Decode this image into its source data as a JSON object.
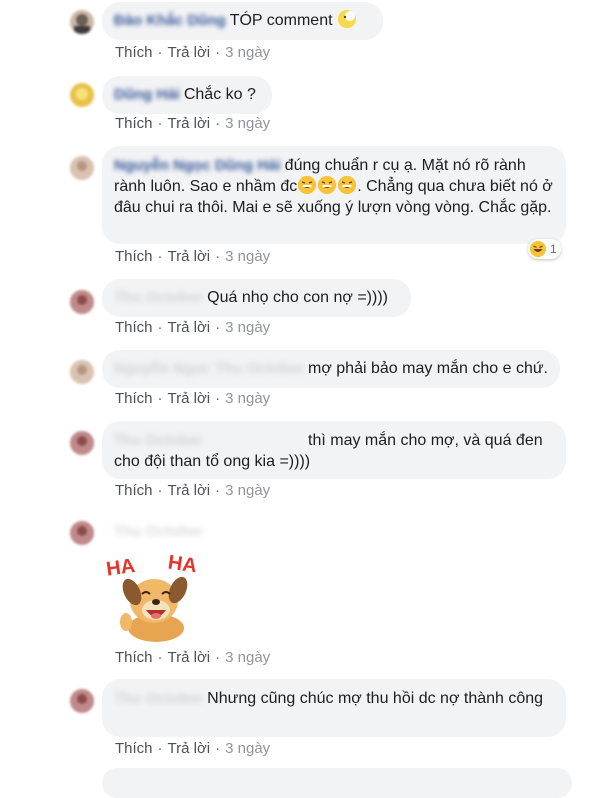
{
  "actions": {
    "like": "Thích",
    "reply": "Trả lời",
    "separator": "·"
  },
  "comments": [
    {
      "author": "Đào Khắc Dũng",
      "text": "TÓP comment",
      "emoji_after": "moon-emoji",
      "time": "3 ngày",
      "avatar_color": "#c9b9a9"
    },
    {
      "author": "Dũng Hải",
      "text": "Chắc ko ?",
      "time": "3 ngày",
      "avatar_color": "#e8c24a"
    },
    {
      "author": "Nguyễn Ngọc Dũng Hải",
      "text_part1": "đúng chuẩn r cụ ạ. Mặt nó rõ rành rành luôn. Sao e nhầm đc",
      "text_part2": ". Chẳng qua chưa biết nó ở đâu chui ra thôi. Mai e sẽ xuống ý lượn vòng vòng. Chắc gặp.",
      "emojis": [
        "grin-sweat-emoji",
        "grin-sweat-emoji",
        "grin-sweat-emoji"
      ],
      "time": "3 ngày",
      "reaction_count": "1",
      "avatar_color": "#d9c2b0"
    },
    {
      "author": "Thu October",
      "text": "Quá nhọ cho con nợ =))))",
      "time": "3 ngày",
      "avatar_color": "#c08a8a"
    },
    {
      "author": "Nguyễn Ngọc Thu October",
      "text": "mợ phải bảo may mắn cho e chứ.",
      "time": "3 ngày",
      "avatar_color": "#d9c2b0"
    },
    {
      "author": "Thu October",
      "text": "thì may mắn cho mợ, và quá đen cho đội than tổ ong kia =))))",
      "time": "3 ngày",
      "avatar_color": "#c08a8a"
    },
    {
      "author": "Thu October",
      "sticker": "haha-dog-sticker",
      "sticker_text": [
        "HA",
        "HA"
      ],
      "time": "3 ngày",
      "avatar_color": "#c08a8a"
    },
    {
      "author": "Thu October",
      "text": "Nhưng cũng chúc mợ thu hồi dc nợ thành công",
      "time": "3 ngày",
      "avatar_color": "#c08a8a"
    }
  ]
}
